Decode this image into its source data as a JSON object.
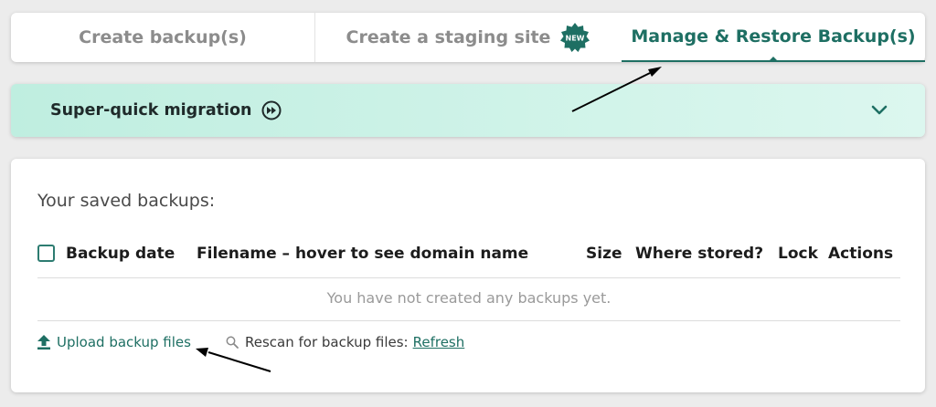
{
  "tabs": [
    {
      "label": "Create backup(s)"
    },
    {
      "label": "Create a staging site",
      "badge": "NEW"
    },
    {
      "label": "Manage & Restore Backup(s)",
      "active": true
    }
  ],
  "migration": {
    "title": "Super-quick migration"
  },
  "backups": {
    "title": "Your saved backups:",
    "columns": [
      "Backup date",
      "Filename – hover to see domain name",
      "Size",
      "Where stored?",
      "Lock",
      "Actions"
    ],
    "empty_message": "You have not created any backups yet.",
    "upload_label": "Upload backup files",
    "rescan_label": "Rescan for backup files:",
    "refresh_label": "Refresh"
  },
  "colors": {
    "accent": "#1e6f63",
    "migration_bg": "#c9f2e6"
  }
}
